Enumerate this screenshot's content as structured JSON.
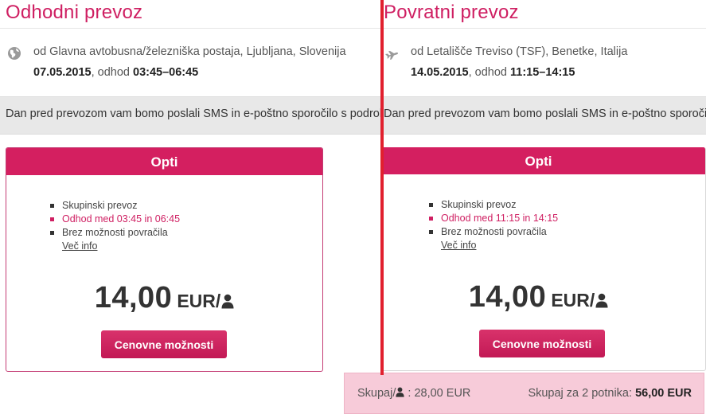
{
  "outbound": {
    "title": "Odhodni prevoz",
    "route_icon": "globe-icon",
    "from": "od Glavna avtobusna/železniška postaja, Ljubljana, Slovenija",
    "date": "07.05.2015",
    "depart_label": ", odhod ",
    "time": "03:45–06:45",
    "sms_notice": "Dan pred prevozom vam bomo poslali SMS in e-poštno sporočilo s podrobnostmi",
    "card": {
      "name": "Opti",
      "features": [
        "Skupinski prevoz",
        "Odhod med 03:45 in 06:45",
        "Brez možnosti povračila"
      ],
      "more_info": "Več info",
      "price": "14,00",
      "currency": "EUR/",
      "button": "Cenovne možnosti"
    }
  },
  "return": {
    "title": "Povratni prevoz",
    "route_icon": "plane-icon",
    "from": "od Letališče Treviso (TSF), Benetke, Italija",
    "date": "14.05.2015",
    "depart_label": ", odhod ",
    "time": "11:15–14:15",
    "sms_notice": "Dan pred prevozom vam bomo poslali SMS in e-poštno sporočilo",
    "card": {
      "name": "Opti",
      "features": [
        "Skupinski prevoz",
        "Odhod med 11:15 in 14:15",
        "Brez možnosti povračila"
      ],
      "more_info": "Več info",
      "price": "14,00",
      "currency": "EUR/",
      "button": "Cenovne možnosti"
    }
  },
  "totals": {
    "per_person_label": "Skupaj/",
    "per_person_value": " : 28,00 EUR",
    "group_label": "Skupaj za 2 potnika: ",
    "group_value": "56,00 EUR"
  },
  "colors": {
    "brand": "#d41f60",
    "divider": "#e1202e",
    "total_bg": "#f7cbd9"
  }
}
